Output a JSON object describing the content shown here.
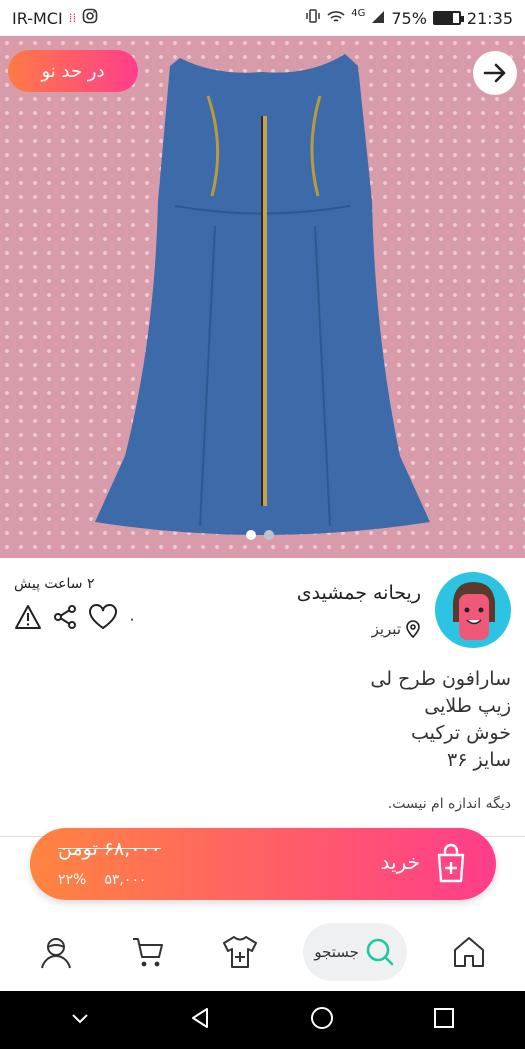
{
  "status": {
    "carrier": "IR-MCI",
    "network": "4G",
    "battery_percent": "75%",
    "time": "21:35",
    "battery_level": 0.75
  },
  "hero": {
    "condition_badge": "در حد نو",
    "page_count": 2,
    "current_page": 1
  },
  "seller": {
    "name": "ریحانه جمشیدی",
    "location": "تبریز",
    "time_ago": "۲ ساعت پیش",
    "like_count": "۰"
  },
  "description": {
    "lines": [
      "سارافون طرح لی",
      "زیپ طلایی",
      "خوش ترکیب",
      "سایز ۳۶"
    ],
    "note": "دیگه اندازه ام نیست."
  },
  "purchase": {
    "label": "خرید",
    "old_price": "۶۸,۰۰۰ تومن",
    "new_price": "۵۳,۰۰۰",
    "discount": "۲۲%"
  },
  "nav": {
    "search_label": "جستجو"
  },
  "colors": {
    "accent_start": "#ff7a45",
    "accent_end": "#ff3e8c",
    "avatar_bg": "#2dc4e3",
    "search_icon": "#1ec9a0"
  }
}
